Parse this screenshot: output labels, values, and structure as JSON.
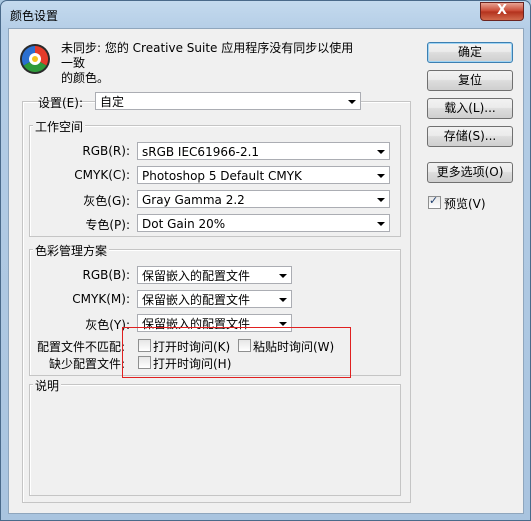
{
  "window": {
    "title": "颜色设置",
    "close_glyph": "X"
  },
  "info": {
    "icon": "color-wheel-icon",
    "line1": "未同步: 您的 Creative Suite 应用程序没有同步以使用一致",
    "line2": "的颜色。"
  },
  "buttons": {
    "ok": "确定",
    "reset": "复位",
    "load": "载入(L)...",
    "save": "存储(S)...",
    "more": "更多选项(O)",
    "preview": "预览(V)",
    "preview_checked": true
  },
  "settings": {
    "label": "设置(E):",
    "value": "自定"
  },
  "working_spaces": {
    "title": "工作空间",
    "rgb_label": "RGB(R):",
    "rgb_value": "sRGB IEC61966-2.1",
    "cmyk_label": "CMYK(C):",
    "cmyk_value": "Photoshop 5 Default CMYK",
    "gray_label": "灰色(G):",
    "gray_value": "Gray Gamma 2.2",
    "spot_label": "专色(P):",
    "spot_value": "Dot Gain 20%"
  },
  "policies": {
    "title": "色彩管理方案",
    "rgb_label": "RGB(B):",
    "rgb_value": "保留嵌入的配置文件",
    "cmyk_label": "CMYK(M):",
    "cmyk_value": "保留嵌入的配置文件",
    "gray_label": "灰色(Y):",
    "gray_value": "保留嵌入的配置文件",
    "mismatch_label": "配置文件不匹配:",
    "mismatch_open": "打开时询问(K)",
    "mismatch_open_checked": false,
    "mismatch_paste": "粘贴时询问(W)",
    "mismatch_paste_checked": false,
    "missing_label": "缺少配置文件:",
    "missing_open": "打开时询问(H)",
    "missing_open_checked": false
  },
  "description": {
    "title": "说明"
  },
  "colors": {
    "highlight": "#e02020"
  }
}
